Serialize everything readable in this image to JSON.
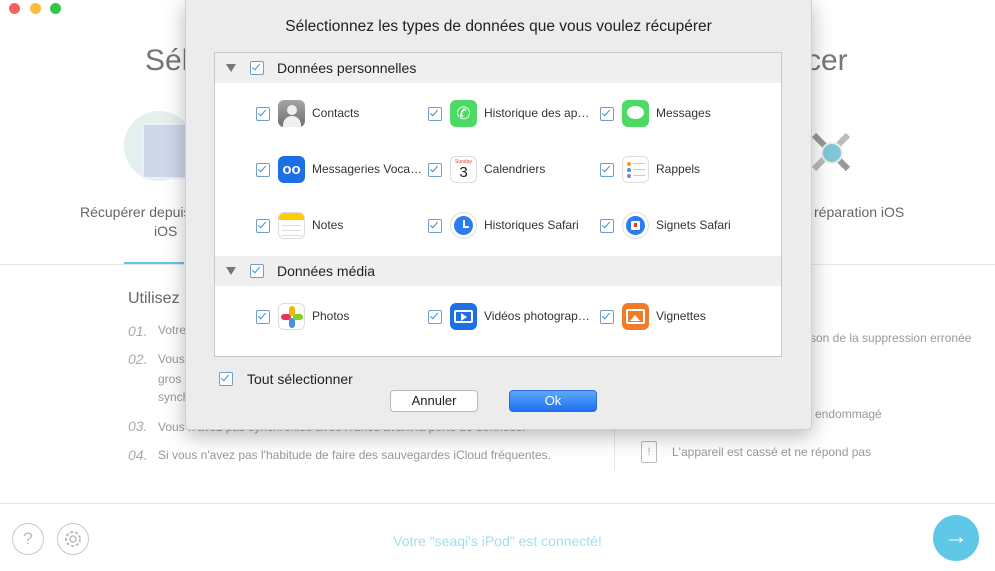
{
  "background": {
    "title_left": "Sél",
    "title_right": "cer",
    "mode_left": {
      "line1": "Récupérer depuis",
      "line2": "iOS"
    },
    "mode_right": {
      "label": "réparation iOS"
    },
    "tips_heading": "Utilisez",
    "tips": [
      {
        "num": "01.",
        "text": "Votre"
      },
      {
        "num": "02.",
        "text": "Vous",
        "line2": "gros",
        "line3": "synchro"
      },
      {
        "num": "03.",
        "text": "Vous n'avez pas synchronisé avec iTunes avant la perte de données."
      },
      {
        "num": "04.",
        "text": "Si vous n'avez pas l'habitude de faire des sauvegardes iCloud fréquentes."
      }
    ],
    "right_tips": [
      "son de la suppression erronée",
      "endommagé",
      "L'appareil est cassé et ne répond pas"
    ],
    "status": "Votre \"seaqi's iPod\" est connecté!",
    "help_glyph": "?",
    "next_glyph": "→"
  },
  "dialog": {
    "title": "Sélectionnez les types de données que vous voulez récupérer",
    "sections": [
      {
        "label": "Données personnelles",
        "items": [
          {
            "label": "Contacts",
            "icon": "contacts-icon"
          },
          {
            "label": "Historique des appels",
            "icon": "phone-icon"
          },
          {
            "label": "Messages",
            "icon": "messages-icon"
          },
          {
            "label": "Messageries Vocales",
            "icon": "voicemail-icon"
          },
          {
            "label": "Calendriers",
            "icon": "calendar-icon",
            "day_name": "Sunday",
            "day_number": "3"
          },
          {
            "label": "Rappels",
            "icon": "reminders-icon"
          },
          {
            "label": "Notes",
            "icon": "notes-icon"
          },
          {
            "label": "Historiques Safari",
            "icon": "safari-history-icon"
          },
          {
            "label": "Signets Safari",
            "icon": "safari-bookmarks-icon"
          }
        ]
      },
      {
        "label": "Données média",
        "items": [
          {
            "label": "Photos",
            "icon": "photos-icon"
          },
          {
            "label": "Vidéos photographiques",
            "icon": "videos-icon"
          },
          {
            "label": "Vignettes",
            "icon": "thumbnails-icon"
          }
        ]
      }
    ],
    "select_all_label": "Tout sélectionner",
    "cancel_label": "Annuler",
    "ok_label": "Ok"
  },
  "colors": {
    "accent": "#2a7cf0",
    "status_text": "#9fdff0",
    "checkbox": "#3b8fd0"
  }
}
